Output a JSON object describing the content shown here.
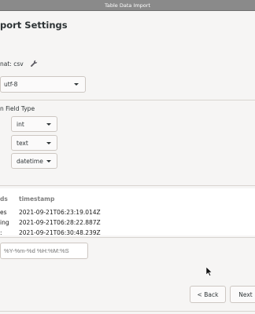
{
  "window": {
    "title": "Table Data Import"
  },
  "page": {
    "heading": "port Settings",
    "format_label": "nat: csv",
    "encoding_value": "utf-8",
    "fields_header": "n  Field Type",
    "field_types": [
      "int",
      "text",
      "datetime"
    ]
  },
  "preview": {
    "col_a_header": "ds",
    "col_b_header": "timestamp",
    "rows": [
      {
        "a": "es",
        "b": "2021-09-21T06:23:19.014Z"
      },
      {
        "a": "ing",
        "b": "2021-09-21T06:28:22.887Z"
      },
      {
        "a": ":",
        "b": "2021-09-21T06:30:48.239Z"
      }
    ]
  },
  "datetime_format": {
    "placeholder": "%Y-%m-%d %H:%M:%S"
  },
  "nav": {
    "back_label": "< Back",
    "next_label": "Next"
  },
  "icons": {
    "format_icon": "wrench-icon",
    "cursor": "mouse-pointer-icon"
  }
}
